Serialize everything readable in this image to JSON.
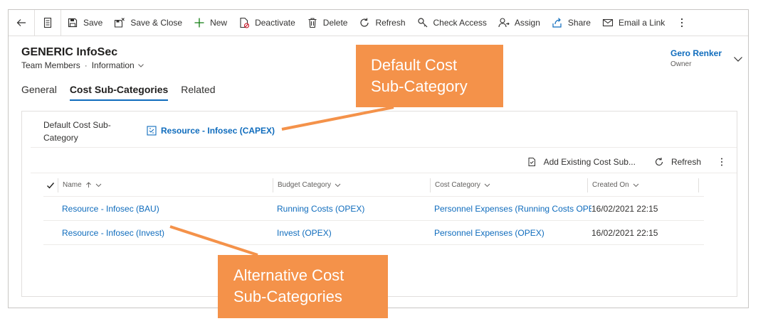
{
  "toolbar": {
    "back_icon": "back-arrow-icon",
    "form_icon": "form-view-icon",
    "items": [
      {
        "label": "Save",
        "icon": "save-icon"
      },
      {
        "label": "Save & Close",
        "icon": "save-close-icon"
      },
      {
        "label": "New",
        "icon": "plus-icon"
      },
      {
        "label": "Deactivate",
        "icon": "deactivate-icon"
      },
      {
        "label": "Delete",
        "icon": "trash-icon"
      },
      {
        "label": "Refresh",
        "icon": "refresh-icon"
      },
      {
        "label": "Check Access",
        "icon": "check-access-icon"
      },
      {
        "label": "Assign",
        "icon": "assign-icon"
      },
      {
        "label": "Share",
        "icon": "share-icon"
      },
      {
        "label": "Email a Link",
        "icon": "email-link-icon"
      }
    ]
  },
  "record": {
    "title": "GENERIC InfoSec",
    "entity": "Team Members",
    "separator": "·",
    "form_name": "Information",
    "owner_name": "Gero Renker",
    "owner_label": "Owner"
  },
  "tabs": [
    {
      "label": "General",
      "active": false
    },
    {
      "label": "Cost Sub-Categories",
      "active": true
    },
    {
      "label": "Related",
      "active": false
    }
  ],
  "section": {
    "field_label": "Default Cost Sub-Category",
    "field_value": "Resource - Infosec (CAPEX)",
    "subgrid_add_label": "Add Existing Cost Sub...",
    "subgrid_refresh_label": "Refresh",
    "columns": {
      "name": "Name",
      "budget_category": "Budget Category",
      "cost_category": "Cost Category",
      "created_on": "Created On"
    },
    "rows": [
      {
        "name": "Resource - Infosec (BAU)",
        "budget_category": "Running Costs (OPEX)",
        "cost_category": "Personnel Expenses (Running Costs OPEX)",
        "created_on": "16/02/2021 22:15"
      },
      {
        "name": "Resource - Infosec (Invest)",
        "budget_category": "Invest (OPEX)",
        "cost_category": "Personnel Expenses (OPEX)",
        "created_on": "16/02/2021 22:15"
      }
    ]
  },
  "annotations": {
    "default_line1": "Default Cost",
    "default_line2": "Sub-Category",
    "alt_line1": "Alternative Cost",
    "alt_line2": "Sub-Categories",
    "color": "#f4924a"
  },
  "colors": {
    "link": "#0f6cbd",
    "border": "#c8c6c4",
    "callout": "#f4924a"
  }
}
